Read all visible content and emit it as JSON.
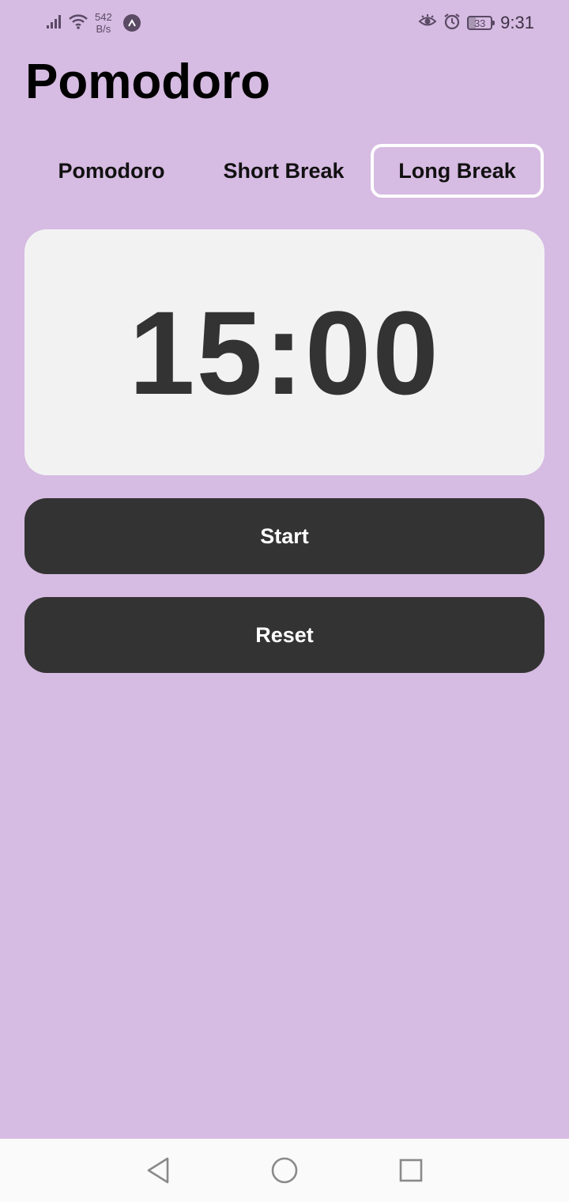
{
  "status_bar": {
    "net_speed_value": "542",
    "net_speed_unit": "B/s",
    "battery_level": "33",
    "time": "9:31",
    "icons": [
      "signal-icon",
      "wifi-icon",
      "app-notification-icon",
      "eye-icon",
      "alarm-icon",
      "battery-icon"
    ]
  },
  "app": {
    "title": "Pomodoro"
  },
  "tabs": [
    {
      "label": "Pomodoro",
      "selected": false
    },
    {
      "label": "Short Break",
      "selected": false
    },
    {
      "label": "Long Break",
      "selected": true
    }
  ],
  "timer": {
    "display": "15:00"
  },
  "buttons": {
    "start_label": "Start",
    "reset_label": "Reset"
  },
  "nav_bar": {
    "icons": [
      "back-icon",
      "home-icon",
      "recents-icon"
    ]
  },
  "colors": {
    "background": "#d6bbe2",
    "card": "#f2f2f3",
    "button": "#333333",
    "button_text": "#ffffff",
    "selected_tab_border": "#ffffff"
  }
}
